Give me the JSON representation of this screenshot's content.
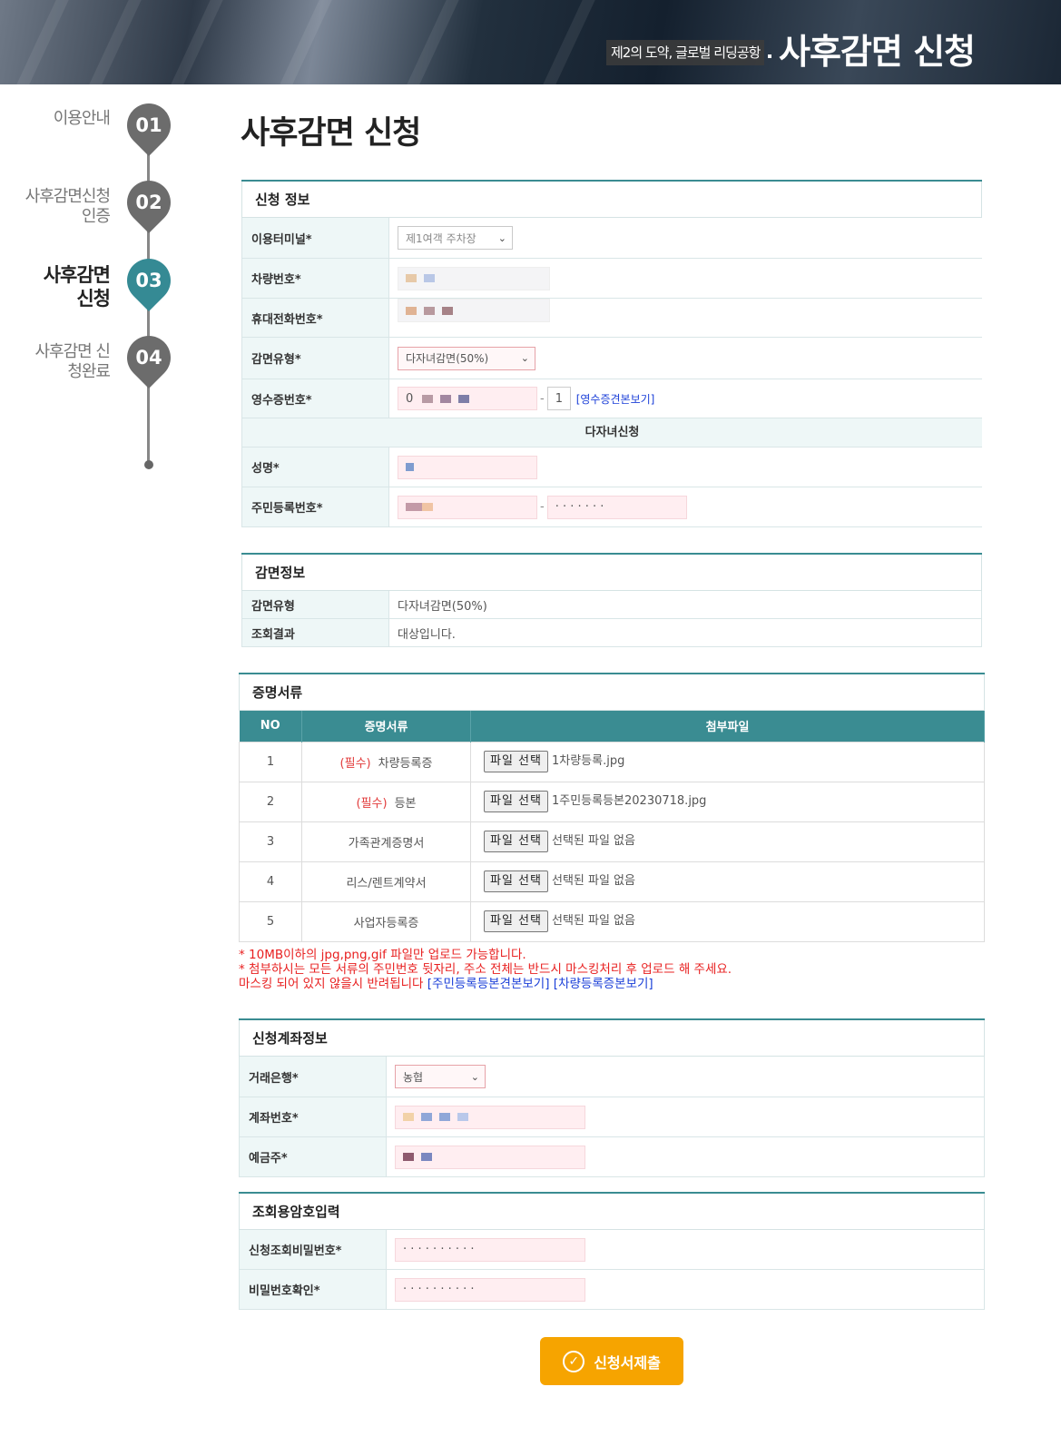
{
  "banner": {
    "subtitle": "제2의 도약, 글로벌 리딩공항",
    "title": "사후감면 신청"
  },
  "steps": [
    {
      "num": "01",
      "label": "이용안내"
    },
    {
      "num": "02",
      "label": "사후감면신청 인증"
    },
    {
      "num": "03",
      "label": "사후감면 신청"
    },
    {
      "num": "04",
      "label": "사후감면 신청완료"
    }
  ],
  "page_title": "사후감면 신청",
  "apply_info": {
    "heading": "신청 정보",
    "terminal_label": "이용터미널*",
    "terminal_value": "제1여객 주차장",
    "car_label": "차량번호*",
    "phone_label": "휴대전화번호*",
    "reduction_label": "감면유형*",
    "reduction_value": "다자녀감면(50%)",
    "receipt_label": "영수증번호*",
    "receipt_prefix": "0",
    "receipt_seq": "1",
    "receipt_link": "[영수증견본보기]",
    "multi_child_heading": "다자녀신청",
    "name_label": "성명*",
    "rrn_label": "주민등록번호*",
    "rrn_masked": "· · · · · · ·"
  },
  "reduction_info": {
    "heading": "감면정보",
    "type_label": "감면유형",
    "type_value": "다자녀감면(50%)",
    "result_label": "조회결과",
    "result_value": "대상입니다."
  },
  "documents": {
    "heading": "증명서류",
    "columns": [
      "NO",
      "증명서류",
      "첨부파일"
    ],
    "required_tag": "(필수)",
    "button_label": "파일 선택",
    "rows": [
      {
        "no": "1",
        "required": true,
        "name": "차량등록증",
        "file": "1차량등록.jpg"
      },
      {
        "no": "2",
        "required": true,
        "name": "등본",
        "file": "1주민등록등본20230718.jpg"
      },
      {
        "no": "3",
        "required": false,
        "name": "가족관계증명서",
        "file": "선택된 파일 없음"
      },
      {
        "no": "4",
        "required": false,
        "name": "리스/렌트계약서",
        "file": "선택된 파일 없음"
      },
      {
        "no": "5",
        "required": false,
        "name": "사업자등록증",
        "file": "선택된 파일 없음"
      }
    ],
    "note1": "* 10MB이하의 jpg,png,gif 파일만 업로드 가능합니다.",
    "note2": "* 첨부하시는 모든 서류의 주민번호 뒷자리, 주소 전체는 반드시 마스킹처리 후 업로드 해 주세요.",
    "note3": "마스킹 되어 있지 않을시 반려됩니다",
    "link1": "[주민등록등본견본보기]",
    "link2": "[차량등록증본보기]"
  },
  "account_info": {
    "heading": "신청계좌정보",
    "bank_label": "거래은행*",
    "bank_value": "농협",
    "account_label": "계좌번호*",
    "holder_label": "예금주*"
  },
  "password_info": {
    "heading": "조회용암호입력",
    "pw_label": "신청조회비밀번호*",
    "pw_confirm_label": "비밀번호확인*",
    "pw_masked": "· · · · · · · · · ·"
  },
  "submit_label": "신청서제출",
  "colors": {
    "accent": "#3a8c92",
    "submit": "#f6a400",
    "required": "#e23b3b",
    "link": "#1b3fd8"
  }
}
